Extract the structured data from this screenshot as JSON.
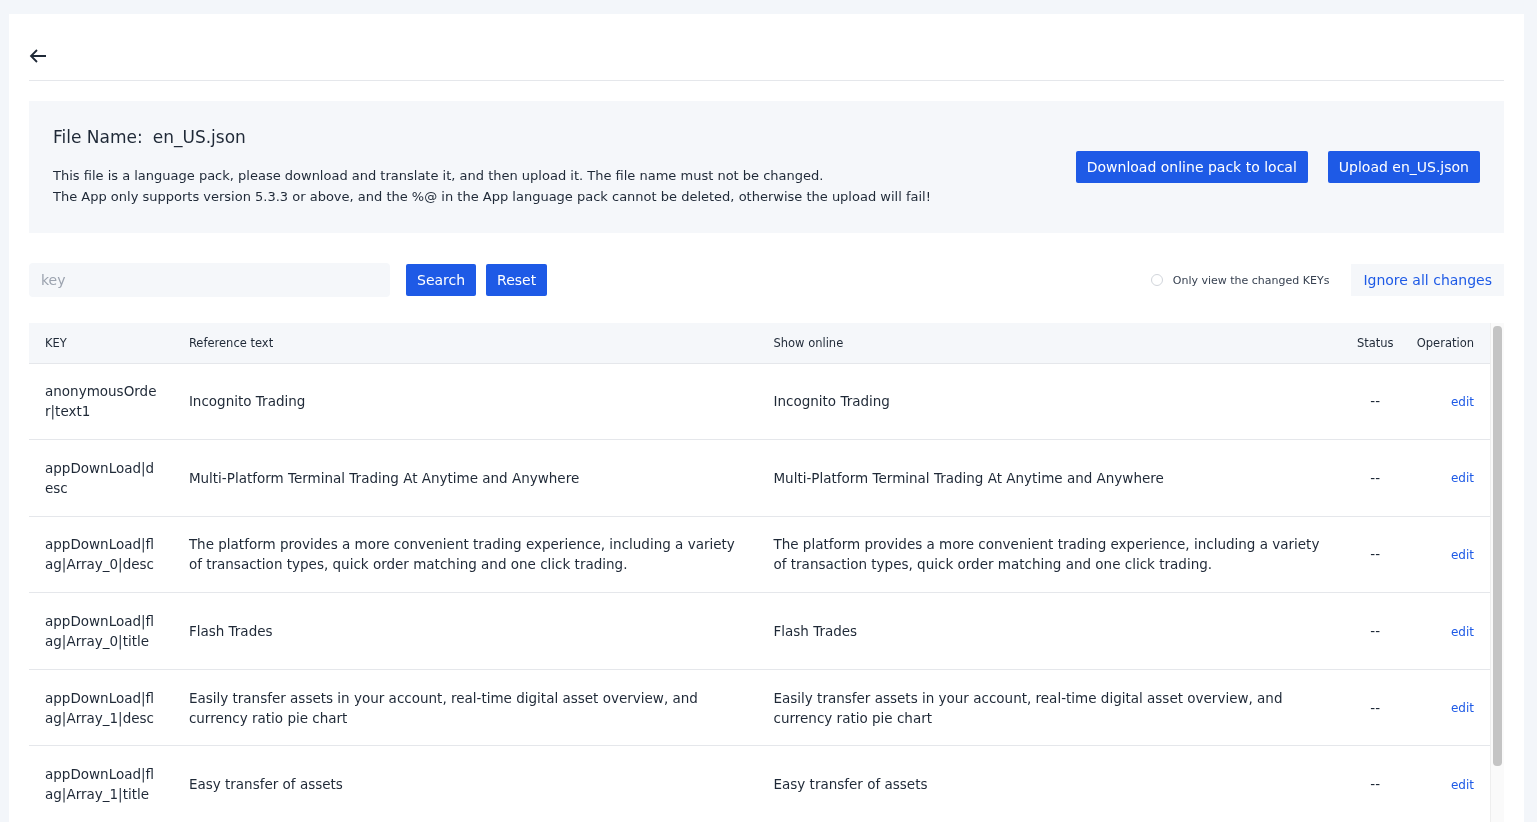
{
  "file_info": {
    "label": "File Name:",
    "file_name": "en_US.json",
    "notes": [
      "This file is a language pack, please download and translate it, and then upload it. The file name must not be changed.",
      "The App only supports version 5.3.3 or above, and the %@ in the App language pack cannot be deleted, otherwise the upload will fail!"
    ],
    "buttons": [
      "Download online pack to local",
      "Upload en_US.json"
    ]
  },
  "search": {
    "placeholder": "key",
    "buttons": [
      "Search",
      "Reset"
    ]
  },
  "filter": {
    "label": "Only view the changed KEYs",
    "checked": false
  },
  "ignore_button": "Ignore all changes",
  "table": {
    "columns": [
      "KEY",
      "Reference text",
      "Show online",
      "Status",
      "Operation"
    ],
    "rows": [
      {
        "key": "anonymousOrder|text1",
        "reference": "Incognito Trading",
        "online": "Incognito Trading",
        "status": "--",
        "action": "edit"
      },
      {
        "key": "appDownLoad|desc",
        "reference": "Multi-Platform Terminal Trading At Anytime and Anywhere",
        "online": "Multi-Platform Terminal Trading At Anytime and Anywhere",
        "status": "--",
        "action": "edit"
      },
      {
        "key": "appDownLoad|flag|Array_0|desc",
        "reference": "The platform provides a more convenient trading experience, including a variety of transaction types, quick order matching and one click trading.",
        "online": "The platform provides a more convenient trading experience, including a variety of transaction types, quick order matching and one click trading.",
        "status": "--",
        "action": "edit"
      },
      {
        "key": "appDownLoad|flag|Array_0|title",
        "reference": "Flash Trades",
        "online": "Flash Trades",
        "status": "--",
        "action": "edit"
      },
      {
        "key": "appDownLoad|flag|Array_1|desc",
        "reference": "Easily transfer assets in your account, real-time digital asset overview, and currency ratio pie chart",
        "online": "Easily transfer assets in your account, real-time digital asset overview, and currency ratio pie chart",
        "status": "--",
        "action": "edit"
      },
      {
        "key": "appDownLoad|flag|Array_1|title",
        "reference": "Easy transfer of assets",
        "online": "Easy transfer of assets",
        "status": "--",
        "action": "edit"
      }
    ]
  }
}
